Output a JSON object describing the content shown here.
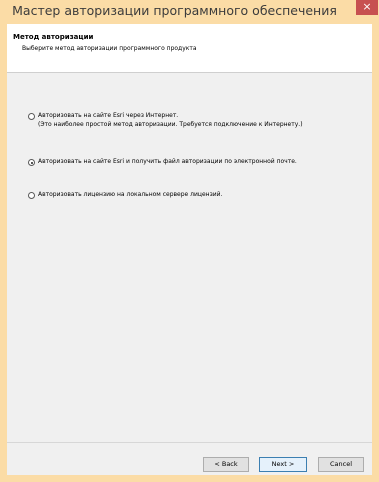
{
  "window": {
    "title": "Мастер авторизации программного обеспечения",
    "close_glyph": "×"
  },
  "header": {
    "title": "Метод авторизации",
    "subtitle": "Выберите метод авторизации программного продукта"
  },
  "options": [
    {
      "line1": "Авторизовать на сайте Esri через Интернет.",
      "line2": "(Это наиболее простой метод авторизации. Требуется подключение к Интернету.)",
      "selected": false
    },
    {
      "line1": "Авторизовать на сайте Esri и получить файл авторизации по электронной почте.",
      "selected": true
    },
    {
      "line1": "Авторизовать лицензию на локальном сервере лицензий.",
      "selected": false
    }
  ],
  "buttons": {
    "back": "< Back",
    "next": "Next >",
    "cancel": "Cancel"
  },
  "colors": {
    "titlebar": "#fbdca6",
    "close": "#c75050",
    "client": "#f0f0f0"
  }
}
